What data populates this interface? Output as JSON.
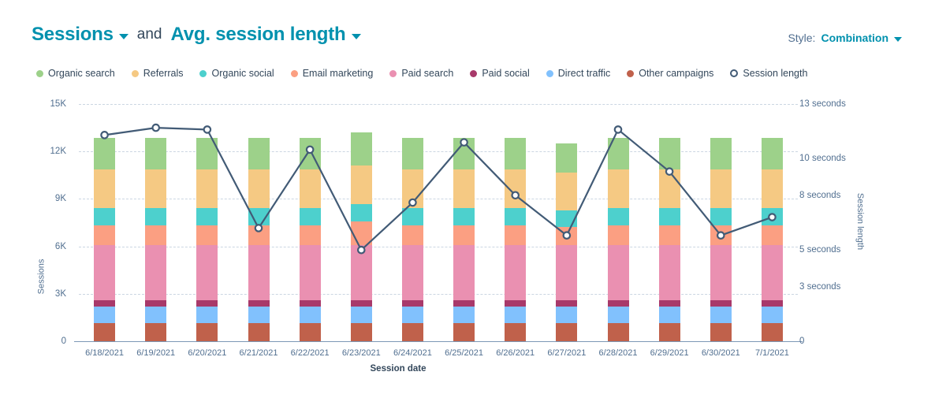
{
  "header": {
    "metric_primary": "Sessions",
    "conjunction": "and",
    "metric_secondary": "Avg. session length",
    "style_word": "Style:",
    "style_value": "Combination"
  },
  "legend": [
    {
      "label": "Organic search",
      "color": "#9dd18a",
      "marker": "dot"
    },
    {
      "label": "Referrals",
      "color": "#f5c983",
      "marker": "dot"
    },
    {
      "label": "Organic social",
      "color": "#4dd0cd",
      "marker": "dot"
    },
    {
      "label": "Email marketing",
      "color": "#fb9f82",
      "marker": "dot"
    },
    {
      "label": "Paid search",
      "color": "#ea90b1",
      "marker": "dot"
    },
    {
      "label": "Paid social",
      "color": "#a8396a",
      "marker": "dot"
    },
    {
      "label": "Direct traffic",
      "color": "#81c1fd",
      "marker": "dot"
    },
    {
      "label": "Other campaigns",
      "color": "#c0614b",
      "marker": "dot"
    },
    {
      "label": "Session length",
      "color": "#425b76",
      "marker": "ring"
    }
  ],
  "chart_data": {
    "type": "bar",
    "subtype": "stacked-bar-with-line-combination",
    "title": "Sessions and Avg. session length",
    "xlabel": "Session date",
    "ylabel": "Sessions",
    "y2label": "Session length",
    "grid": true,
    "legend_position": "top-left",
    "categories": [
      "6/18/2021",
      "6/19/2021",
      "6/20/2021",
      "6/21/2021",
      "6/22/2021",
      "6/23/2021",
      "6/24/2021",
      "6/25/2021",
      "6/26/2021",
      "6/27/2021",
      "6/28/2021",
      "6/29/2021",
      "6/30/2021",
      "7/1/2021"
    ],
    "ylim": [
      0,
      15000
    ],
    "yticks": [
      0,
      3000,
      6000,
      9000,
      12000,
      15000
    ],
    "yticklabels": [
      "0",
      "3K",
      "6K",
      "9K",
      "12K",
      "15K"
    ],
    "y2lim": [
      0,
      13
    ],
    "y2ticks": [
      0,
      3,
      5,
      8,
      10,
      13
    ],
    "y2ticklabels": [
      "0",
      "3 seconds",
      "5 seconds",
      "8 seconds",
      "10 seconds",
      "13 seconds"
    ],
    "series": [
      {
        "name": "Other campaigns",
        "color": "#c0614b",
        "values": [
          1150,
          1150,
          1150,
          1150,
          1150,
          1150,
          1150,
          1150,
          1150,
          1150,
          1150,
          1150,
          1150,
          1150
        ]
      },
      {
        "name": "Direct traffic",
        "color": "#81c1fd",
        "values": [
          1050,
          1050,
          1050,
          1050,
          1050,
          1050,
          1050,
          1050,
          1050,
          1050,
          1050,
          1050,
          1050,
          1050
        ]
      },
      {
        "name": "Paid social",
        "color": "#a8396a",
        "values": [
          400,
          400,
          400,
          400,
          400,
          400,
          400,
          400,
          400,
          400,
          400,
          400,
          400,
          400
        ]
      },
      {
        "name": "Paid search",
        "color": "#ea90b1",
        "values": [
          3500,
          3500,
          3500,
          3500,
          3500,
          3500,
          3500,
          3500,
          3500,
          3500,
          3500,
          3500,
          3500,
          3500
        ]
      },
      {
        "name": "Email marketing",
        "color": "#fb9f82",
        "values": [
          1250,
          1250,
          1250,
          1250,
          1250,
          1500,
          1250,
          1250,
          1250,
          1150,
          1250,
          1250,
          1250,
          1250
        ]
      },
      {
        "name": "Organic social",
        "color": "#4dd0cd",
        "values": [
          1050,
          1050,
          1050,
          1050,
          1050,
          1050,
          1050,
          1050,
          1050,
          1000,
          1050,
          1050,
          1050,
          1050
        ]
      },
      {
        "name": "Referrals",
        "color": "#f5c983",
        "values": [
          2450,
          2450,
          2450,
          2450,
          2450,
          2450,
          2450,
          2450,
          2450,
          2400,
          2450,
          2450,
          2450,
          2450
        ]
      },
      {
        "name": "Organic search",
        "color": "#9dd18a",
        "values": [
          2000,
          2000,
          2000,
          2000,
          2000,
          2100,
          2000,
          2000,
          2000,
          1850,
          2000,
          2000,
          2000,
          2000
        ]
      }
    ],
    "line_series": {
      "name": "Session length",
      "color": "#425b76",
      "axis": "y2",
      "unit": "seconds",
      "values": [
        11.3,
        11.7,
        11.6,
        6.2,
        10.5,
        5.0,
        7.6,
        10.9,
        8.0,
        5.8,
        11.6,
        9.3,
        5.8,
        6.8
      ]
    }
  }
}
